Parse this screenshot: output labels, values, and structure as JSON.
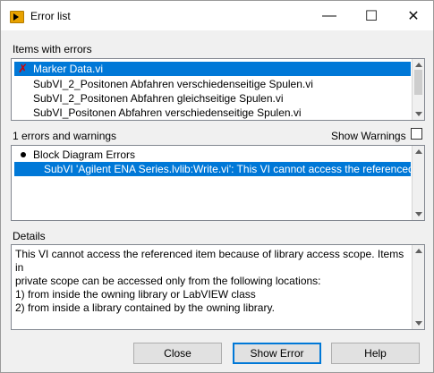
{
  "window": {
    "title": "Error list",
    "minimize": "—",
    "maximize": "☐",
    "close": "✕"
  },
  "items_with_errors": {
    "label": "Items with errors",
    "items": [
      {
        "text": "Marker Data.vi"
      },
      {
        "text": "SubVI_2_Positonen Abfahren verschiedenseitige Spulen.vi"
      },
      {
        "text": "SubVI_2_Positonen Abfahren gleichseitige Spulen.vi"
      },
      {
        "text": "SubVI_Positonen Abfahren verschiedenseitige Spulen.vi"
      }
    ]
  },
  "errors_and_warnings": {
    "label": "1 errors and warnings",
    "show_warnings_label": "Show Warnings",
    "group": "Block Diagram Errors",
    "entry": "SubVI 'Agilent ENA Series.lvlib:Write.vi': This VI cannot access the referenced item because of library access scope."
  },
  "details": {
    "label": "Details",
    "lines": [
      "This VI cannot access the referenced item because of library access scope. Items in",
      "private scope can be accessed only from the following locations:",
      "1) from inside the owning library or LabVIEW class",
      "2) from inside a library contained by the owning library."
    ]
  },
  "buttons": {
    "close": "Close",
    "show_error": "Show Error",
    "help": "Help"
  }
}
